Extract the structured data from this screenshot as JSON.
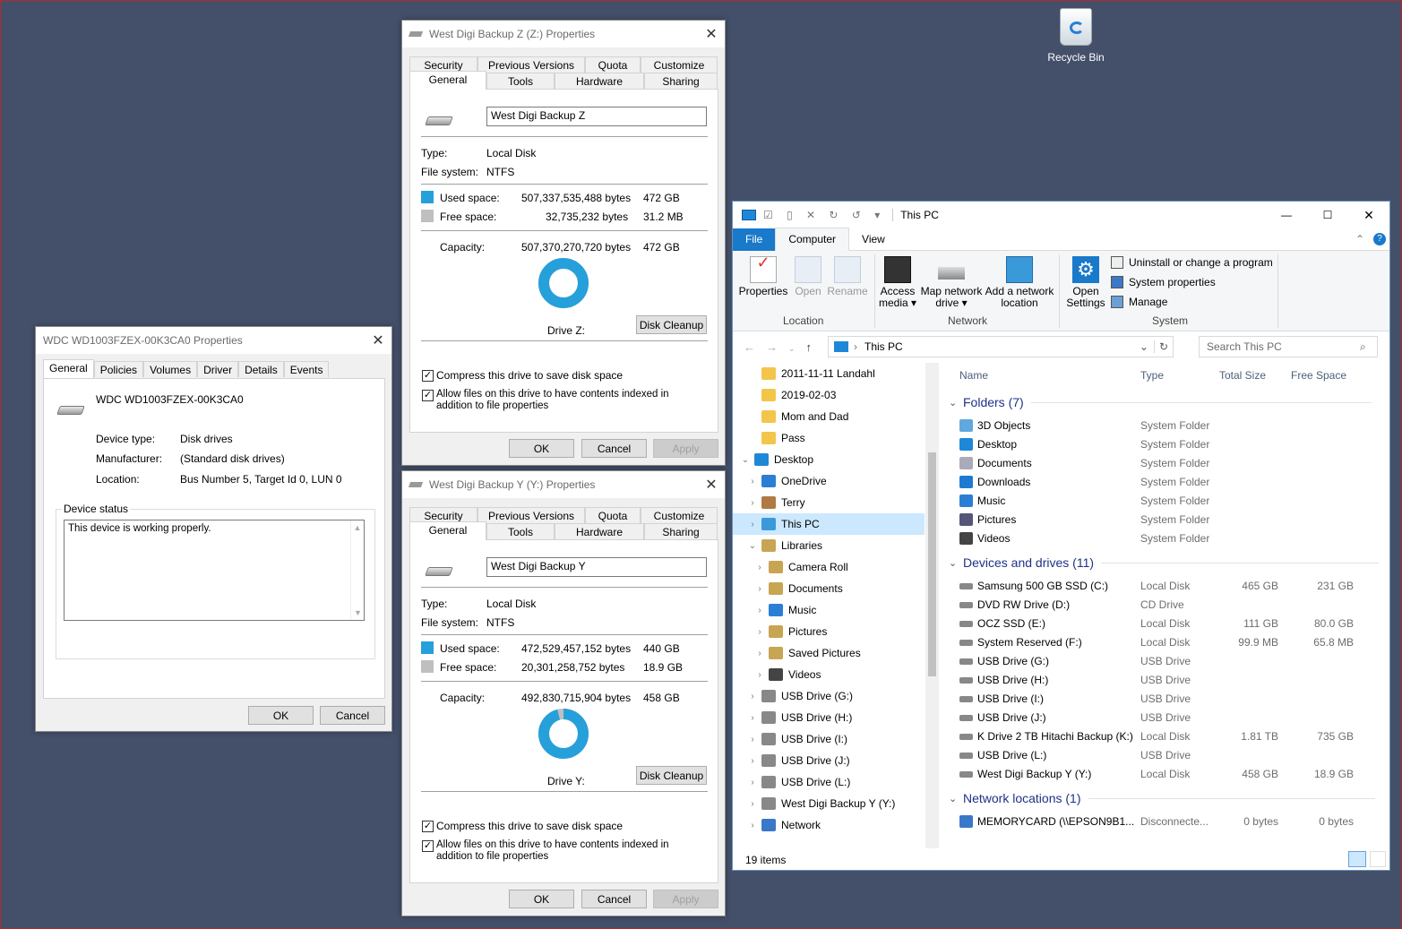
{
  "desktop": {
    "recycle_bin_label": "Recycle Bin"
  },
  "dialog_z": {
    "title": "West Digi Backup Z (Z:) Properties",
    "tabs_top": [
      "Security",
      "Previous Versions",
      "Quota",
      "Customize"
    ],
    "tabs_bottom": [
      "General",
      "Tools",
      "Hardware",
      "Sharing"
    ],
    "name_value": "West Digi Backup Z",
    "type_label": "Type:",
    "type_value": "Local Disk",
    "fs_label": "File system:",
    "fs_value": "NTFS",
    "used_label": "Used space:",
    "used_bytes": "507,337,535,488 bytes",
    "used_gb": "472 GB",
    "free_label": "Free space:",
    "free_bytes": "32,735,232 bytes",
    "free_gb": "31.2 MB",
    "cap_label": "Capacity:",
    "cap_bytes": "507,370,270,720 bytes",
    "cap_gb": "472 GB",
    "drive_label": "Drive Z:",
    "used_fraction": 0.9999,
    "disk_cleanup": "Disk Cleanup",
    "compress_label": "Compress this drive to save disk space",
    "index_label": "Allow files on this drive to have contents indexed in addition to file properties",
    "ok": "OK",
    "cancel": "Cancel",
    "apply": "Apply",
    "used_color": "#26a0da",
    "free_color": "#bfbfbf"
  },
  "dialog_y": {
    "title": "West Digi Backup Y (Y:) Properties",
    "tabs_top": [
      "Security",
      "Previous Versions",
      "Quota",
      "Customize"
    ],
    "tabs_bottom": [
      "General",
      "Tools",
      "Hardware",
      "Sharing"
    ],
    "name_value": "West Digi Backup Y",
    "type_label": "Type:",
    "type_value": "Local Disk",
    "fs_label": "File system:",
    "fs_value": "NTFS",
    "used_label": "Used space:",
    "used_bytes": "472,529,457,152 bytes",
    "used_gb": "440 GB",
    "free_label": "Free space:",
    "free_bytes": "20,301,258,752 bytes",
    "free_gb": "18.9 GB",
    "cap_label": "Capacity:",
    "cap_bytes": "492,830,715,904 bytes",
    "cap_gb": "458 GB",
    "drive_label": "Drive Y:",
    "used_fraction": 0.9588,
    "disk_cleanup": "Disk Cleanup",
    "compress_label": "Compress this drive to save disk space",
    "index_label": "Allow files on this drive to have contents indexed in addition to file properties",
    "ok": "OK",
    "cancel": "Cancel",
    "apply": "Apply",
    "used_color": "#26a0da",
    "free_color": "#bfbfbf"
  },
  "wdc": {
    "title": "WDC WD1003FZEX-00K3CA0 Properties",
    "tabs": [
      "General",
      "Policies",
      "Volumes",
      "Driver",
      "Details",
      "Events"
    ],
    "device_name": "WDC WD1003FZEX-00K3CA0",
    "device_type_label": "Device type:",
    "device_type": "Disk drives",
    "manufacturer_label": "Manufacturer:",
    "manufacturer": "(Standard disk drives)",
    "location_label": "Location:",
    "location": "Bus Number 5, Target Id 0, LUN 0",
    "status_group": "Device status",
    "status_text": "This device is working properly.",
    "ok": "OK",
    "cancel": "Cancel"
  },
  "explorer": {
    "title": "This PC",
    "tabs": [
      "File",
      "Computer",
      "View"
    ],
    "ribbon": {
      "properties": "Properties",
      "open": "Open",
      "rename": "Rename",
      "location_group": "Location",
      "access_media": "Access media ▾",
      "map_network_drive": "Map network drive ▾",
      "add_network_location": "Add a network location",
      "network_group": "Network",
      "open_settings": "Open Settings",
      "uninstall": "Uninstall or change a program",
      "system_properties": "System properties",
      "manage": "Manage",
      "system_group": "System"
    },
    "address": "This PC",
    "search_placeholder": "Search This PC",
    "nav": [
      {
        "label": "2011-11-11 Landahl",
        "indent": 1,
        "chev": "",
        "icon": "folder"
      },
      {
        "label": "2019-02-03",
        "indent": 1,
        "chev": "",
        "icon": "folder"
      },
      {
        "label": "Mom and Dad",
        "indent": 1,
        "chev": "",
        "icon": "folder"
      },
      {
        "label": "Pass",
        "indent": 1,
        "chev": "",
        "icon": "folder"
      },
      {
        "label": "Desktop",
        "indent": 0,
        "chev": "⌄",
        "icon": "desktop"
      },
      {
        "label": "OneDrive",
        "indent": 1,
        "chev": "›",
        "icon": "cloud"
      },
      {
        "label": "Terry",
        "indent": 1,
        "chev": "›",
        "icon": "user"
      },
      {
        "label": "This PC",
        "indent": 1,
        "chev": "›",
        "icon": "pc",
        "selected": true
      },
      {
        "label": "Libraries",
        "indent": 1,
        "chev": "⌄",
        "icon": "library"
      },
      {
        "label": "Camera Roll",
        "indent": 2,
        "chev": "›",
        "icon": "library"
      },
      {
        "label": "Documents",
        "indent": 2,
        "chev": "›",
        "icon": "library"
      },
      {
        "label": "Music",
        "indent": 2,
        "chev": "›",
        "icon": "music"
      },
      {
        "label": "Pictures",
        "indent": 2,
        "chev": "›",
        "icon": "library"
      },
      {
        "label": "Saved Pictures",
        "indent": 2,
        "chev": "›",
        "icon": "library"
      },
      {
        "label": "Videos",
        "indent": 2,
        "chev": "›",
        "icon": "video"
      },
      {
        "label": "USB Drive (G:)",
        "indent": 1,
        "chev": "›",
        "icon": "drive"
      },
      {
        "label": "USB Drive (H:)",
        "indent": 1,
        "chev": "›",
        "icon": "drive"
      },
      {
        "label": "USB Drive (I:)",
        "indent": 1,
        "chev": "›",
        "icon": "drive"
      },
      {
        "label": "USB Drive (J:)",
        "indent": 1,
        "chev": "›",
        "icon": "drive"
      },
      {
        "label": "USB Drive (L:)",
        "indent": 1,
        "chev": "›",
        "icon": "drive"
      },
      {
        "label": "West Digi Backup Y (Y:)",
        "indent": 1,
        "chev": "›",
        "icon": "drive"
      },
      {
        "label": "Network",
        "indent": 1,
        "chev": "›",
        "icon": "network"
      }
    ],
    "columns": [
      "Name",
      "Type",
      "Total Size",
      "Free Space"
    ],
    "folders_header": "Folders (7)",
    "folders": [
      {
        "name": "3D Objects",
        "type": "System Folder",
        "icon": "cube"
      },
      {
        "name": "Desktop",
        "type": "System Folder",
        "icon": "desktop"
      },
      {
        "name": "Documents",
        "type": "System Folder",
        "icon": "doc"
      },
      {
        "name": "Downloads",
        "type": "System Folder",
        "icon": "download"
      },
      {
        "name": "Music",
        "type": "System Folder",
        "icon": "music"
      },
      {
        "name": "Pictures",
        "type": "System Folder",
        "icon": "picture"
      },
      {
        "name": "Videos",
        "type": "System Folder",
        "icon": "video"
      }
    ],
    "devices_header": "Devices and drives (11)",
    "devices": [
      {
        "name": "Samsung 500 GB SSD (C:)",
        "type": "Local Disk",
        "total": "465 GB",
        "free": "231 GB"
      },
      {
        "name": "DVD RW Drive (D:)",
        "type": "CD Drive",
        "total": "",
        "free": ""
      },
      {
        "name": "OCZ SSD (E:)",
        "type": "Local Disk",
        "total": "111 GB",
        "free": "80.0 GB"
      },
      {
        "name": "System Reserved (F:)",
        "type": "Local Disk",
        "total": "99.9 MB",
        "free": "65.8 MB"
      },
      {
        "name": "USB Drive (G:)",
        "type": "USB Drive",
        "total": "",
        "free": ""
      },
      {
        "name": "USB Drive (H:)",
        "type": "USB Drive",
        "total": "",
        "free": ""
      },
      {
        "name": "USB Drive (I:)",
        "type": "USB Drive",
        "total": "",
        "free": ""
      },
      {
        "name": "USB Drive (J:)",
        "type": "USB Drive",
        "total": "",
        "free": ""
      },
      {
        "name": "K Drive 2 TB Hitachi Backup (K:)",
        "type": "Local Disk",
        "total": "1.81 TB",
        "free": "735 GB"
      },
      {
        "name": "USB Drive (L:)",
        "type": "USB Drive",
        "total": "",
        "free": ""
      },
      {
        "name": "West Digi Backup Y (Y:)",
        "type": "Local Disk",
        "total": "458 GB",
        "free": "18.9 GB"
      }
    ],
    "network_header": "Network locations (1)",
    "network": [
      {
        "name": "MEMORYCARD (\\\\EPSON9B1...",
        "type": "Disconnecte...",
        "total": "0 bytes",
        "free": "0 bytes"
      }
    ],
    "status": "19 items"
  }
}
